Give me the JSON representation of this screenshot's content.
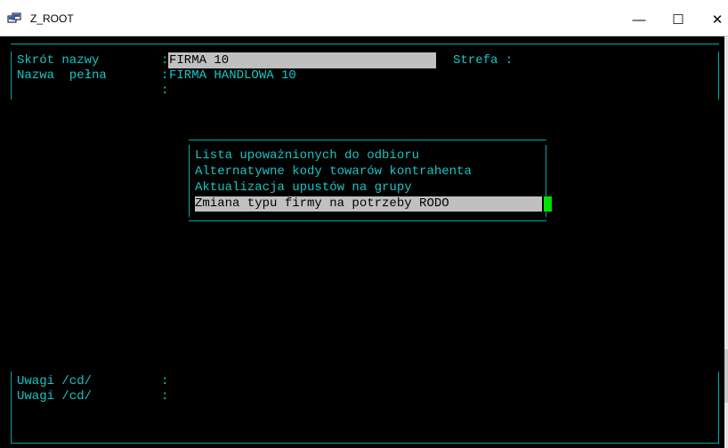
{
  "window": {
    "title": "Z_ROOT",
    "minimize": "—",
    "maximize": "☐",
    "close": "✕"
  },
  "form": {
    "skrot_label": "Skrót nazwy",
    "skrot_value": "FIRMA 10",
    "strefa_label": "Strefa :",
    "nazwa_label": "Nazwa  pełna",
    "nazwa_value": "FIRMA HANDLOWA 10",
    "colon": ":",
    "uwagi1_label": "Uwagi /cd/",
    "uwagi2_label": "Uwagi /cd/"
  },
  "menu": {
    "items": [
      "Lista upoważnionych do odbioru",
      "Alternatywne kody towarów kontrahenta",
      "Aktualizacja upustów na grupy",
      "Zmiana typu firmy na potrzeby RODO"
    ],
    "selected_index": 3
  },
  "colors": {
    "text": "#19c5c5",
    "border": "#00aaaa",
    "highlight": "#c0c0c0",
    "cursor": "#00e000"
  }
}
